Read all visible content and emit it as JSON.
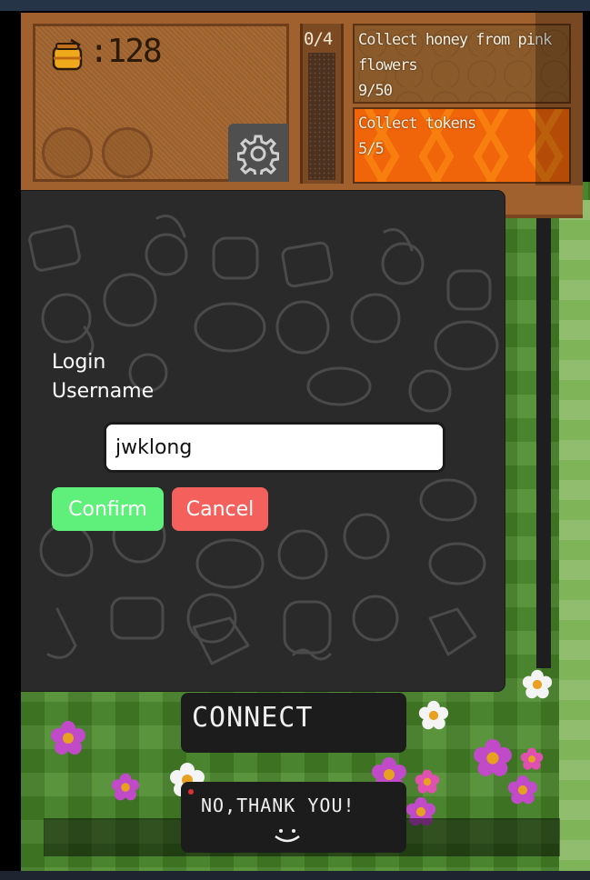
{
  "hud": {
    "honey_icon": "honey-jar-icon",
    "honey_count": ":128",
    "settings_icon": "gear-icon",
    "quest_progress": "0/4"
  },
  "quests": [
    {
      "text": "Collect honey from pink flowers",
      "progress": "9/50",
      "completion": 0.18
    },
    {
      "text": "Collect tokens",
      "progress": "5/5",
      "completion": 1.0
    }
  ],
  "login": {
    "title": "Login",
    "username_label": "Username",
    "username_value": "jwklong",
    "confirm_label": "Confirm",
    "cancel_label": "Cancel"
  },
  "world_buttons": {
    "connect_label": "CONNECT",
    "no_thanks_label": "NO,THANK YOU!"
  },
  "colors": {
    "confirm": "#5ef07a",
    "cancel": "#f4605c",
    "modal_bg": "#2a2a2a",
    "grass": "#4a8a2a",
    "hive_wood": "#a0612e"
  }
}
